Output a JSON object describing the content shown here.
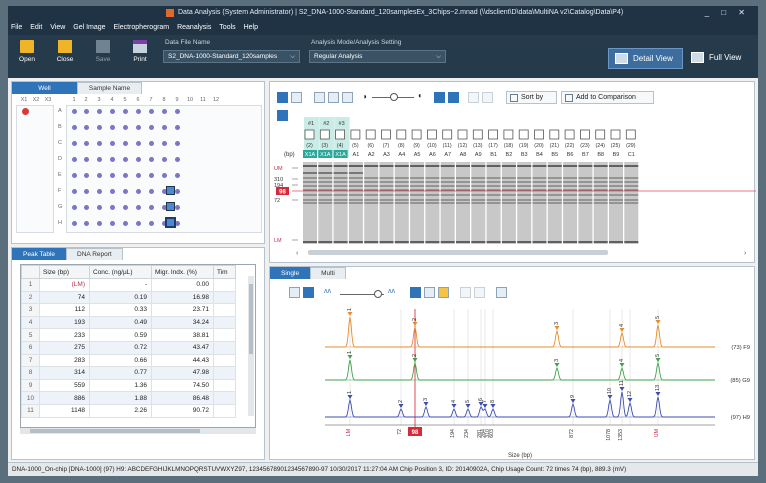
{
  "window": {
    "title": "Data Analysis  (System Administrator)  |  S2_DNA-1000-Standard_120samplesEx_3Chips~2.mnad  (\\\\dsclient\\D\\data\\MultiNA v2\\Catalog\\Data\\P4)",
    "controls": "_ □ ✕"
  },
  "menu": [
    "File",
    "Edit",
    "View",
    "Gel Image",
    "Electropherogram",
    "Reanalysis",
    "Tools",
    "Help"
  ],
  "toolbar": {
    "buttons": [
      "Open",
      "Close",
      "Save",
      "Print"
    ],
    "file_label": "Data File Name",
    "file_value": "S2_DNA-1000-Standard_120samples",
    "mode_label": "Analysis Mode/Analysis Setting",
    "mode_value": "Regular Analysis",
    "detail_view": "Detail View",
    "full_view": "Full View"
  },
  "plate_tabs": [
    "Well",
    "Sample Name"
  ],
  "plate": {
    "col_headers": [
      "X1",
      "X2",
      "X3",
      "1",
      "2",
      "3",
      "4",
      "5",
      "6",
      "7",
      "8",
      "9",
      "10",
      "11",
      "12"
    ],
    "row_headers": [
      "A",
      "B",
      "C",
      "D",
      "E",
      "F",
      "G",
      "H"
    ]
  },
  "table_tabs": [
    "Peak Table",
    "DNA Report"
  ],
  "peak_table": {
    "headers": [
      "",
      "Size (bp)",
      "Conc. (ng/µL)",
      "Migr. Indx. (%)",
      "Tim"
    ],
    "rows": [
      [
        "1",
        "(LM)",
        "-",
        "0.00"
      ],
      [
        "2",
        "74",
        "0.19",
        "16.98"
      ],
      [
        "3",
        "112",
        "0.33",
        "23.71"
      ],
      [
        "4",
        "193",
        "0.49",
        "34.24"
      ],
      [
        "5",
        "233",
        "0.59",
        "38.81"
      ],
      [
        "6",
        "275",
        "0.72",
        "43.47"
      ],
      [
        "7",
        "283",
        "0.66",
        "44.43"
      ],
      [
        "8",
        "314",
        "0.77",
        "47.98"
      ],
      [
        "9",
        "559",
        "1.36",
        "74.50"
      ],
      [
        "10",
        "886",
        "1.88",
        "86.48"
      ],
      [
        "11",
        "1148",
        "2.26",
        "90.72"
      ]
    ]
  },
  "gel_toolbar": {
    "sort_by": "Sort by",
    "add_to_comparison": "Add to Comparison"
  },
  "gel": {
    "selected_headers": [
      "#1",
      "#2",
      "#3"
    ],
    "bp_label": "(bp)",
    "lanes": [
      {
        "num": "(2)",
        "name": "X1A"
      },
      {
        "num": "(3)",
        "name": "X1A"
      },
      {
        "num": "(4)",
        "name": "X1A"
      },
      {
        "num": "(5)",
        "name": "A1"
      },
      {
        "num": "(6)",
        "name": "A2"
      },
      {
        "num": "(7)",
        "name": "A3"
      },
      {
        "num": "(8)",
        "name": "A4"
      },
      {
        "num": "(9)",
        "name": "A5"
      },
      {
        "num": "(10)",
        "name": "A6"
      },
      {
        "num": "(11)",
        "name": "A7"
      },
      {
        "num": "(12)",
        "name": "A8"
      },
      {
        "num": "(13)",
        "name": "A9"
      },
      {
        "num": "(17)",
        "name": "B1"
      },
      {
        "num": "(18)",
        "name": "B2"
      },
      {
        "num": "(19)",
        "name": "B3"
      },
      {
        "num": "(20)",
        "name": "B4"
      },
      {
        "num": "(21)",
        "name": "B5"
      },
      {
        "num": "(22)",
        "name": "B6"
      },
      {
        "num": "(23)",
        "name": "B7"
      },
      {
        "num": "(24)",
        "name": "B8"
      },
      {
        "num": "(25)",
        "name": "B9"
      },
      {
        "num": "(29)",
        "name": "C1"
      }
    ],
    "y_labels": [
      "UM",
      "310",
      "194",
      "98",
      "72",
      "LM"
    ]
  },
  "ep_tabs": [
    "Single",
    "Multi"
  ],
  "electropherogram": {
    "traces": [
      "(73) F9",
      "(85) G9",
      "(97) H9"
    ],
    "x_ticks": [
      "LM",
      "72",
      "98",
      "194",
      "234",
      "281",
      "284",
      "310",
      "603",
      "872",
      "1078",
      "1353",
      "UM"
    ],
    "x_label": "Size (bp)",
    "marker_label": "98",
    "peak_labels": [
      "1",
      "2",
      "3",
      "4",
      "5",
      "6",
      "7",
      "8",
      "9",
      "10",
      "11",
      "12",
      "13"
    ]
  },
  "status_bar": "DNA-1000_On-chip  [DNA-1000]    (97) H9: ABCDEFGHIJKLMNOPQRSTUVWXYZ97, 12345678901234567890-97      10/30/2017 11:27:04 AM     Chip Position 3, ID: 20140902A, Chip Usage Count: 72 times    74 (bp), 889.3 (mV)"
}
